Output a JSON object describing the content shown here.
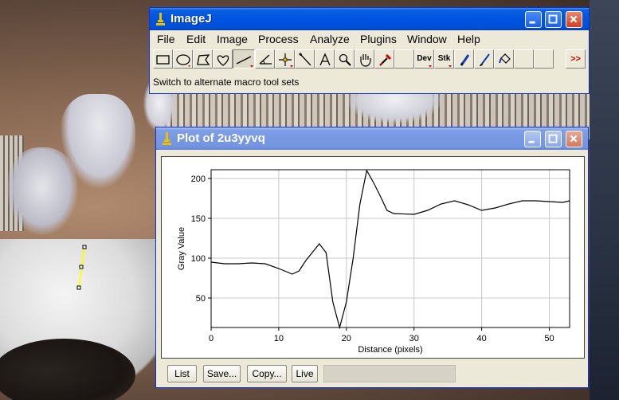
{
  "imagej": {
    "title": "ImageJ",
    "menu": [
      "File",
      "Edit",
      "Image",
      "Process",
      "Analyze",
      "Plugins",
      "Window",
      "Help"
    ],
    "tools": {
      "dev_label": "Dev",
      "stk_label": "Stk",
      "more_label": ">>"
    },
    "status_text": "Switch to alternate macro tool sets"
  },
  "plot_window": {
    "title": "Plot of 2u3yyvq",
    "buttons": {
      "list": "List",
      "save": "Save...",
      "copy": "Copy...",
      "live": "Live"
    },
    "coordinates_text": ""
  },
  "chart_data": {
    "type": "line",
    "title": "",
    "xlabel": "Distance (pixels)",
    "ylabel": "Gray Value",
    "xlim": [
      0,
      53
    ],
    "ylim": [
      13,
      211
    ],
    "x_ticks": [
      0,
      10,
      20,
      30,
      40,
      50
    ],
    "y_ticks": [
      50,
      100,
      150,
      200
    ],
    "grid": true,
    "series": [
      {
        "color": "#000000",
        "x": [
          0,
          2,
          4,
          6,
          8,
          10,
          12,
          13,
          14,
          16,
          17,
          18,
          19,
          20,
          21,
          22,
          23,
          24,
          25,
          26,
          27,
          30,
          32,
          34,
          36,
          38,
          40,
          42,
          44,
          46,
          48,
          50,
          52,
          53
        ],
        "y": [
          95,
          93,
          93,
          94,
          93,
          87,
          80,
          84,
          97,
          118,
          107,
          45,
          13,
          45,
          100,
          168,
          210,
          195,
          178,
          160,
          156,
          155,
          160,
          168,
          172,
          167,
          160,
          163,
          168,
          172,
          172,
          171,
          170,
          172
        ]
      }
    ]
  }
}
